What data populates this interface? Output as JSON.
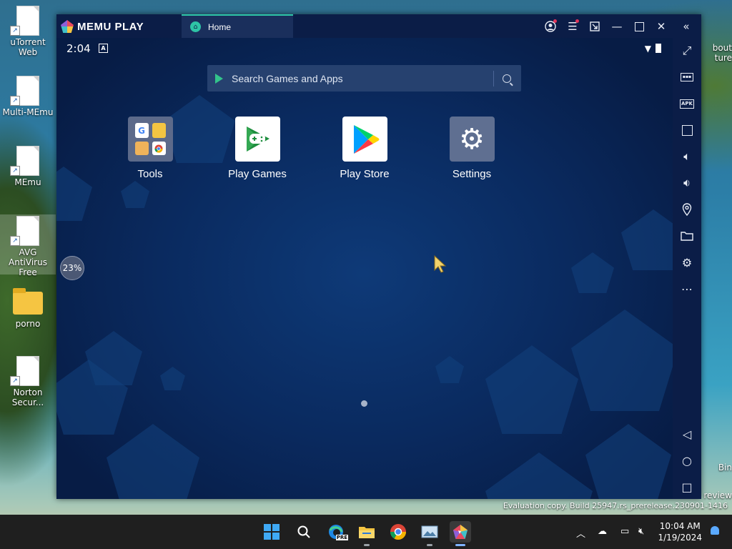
{
  "desktop": {
    "icons": [
      {
        "label": "uTorrent Web"
      },
      {
        "label": "Multi-MEmu"
      },
      {
        "label": "MEmu"
      },
      {
        "label": "AVG AntiVirus Free"
      },
      {
        "label": "porno"
      },
      {
        "label": "Norton Secur..."
      }
    ],
    "right_peek": {
      "top": "bout",
      "top2": "ture",
      "bin": "Bin",
      "review": "review"
    },
    "watermark": "Evaluation copy. Build 25947.rs_prerelease.230901-1416"
  },
  "emulator": {
    "brand": "MEMU PLAY",
    "tab_label": "Home",
    "status": {
      "time": "2:04",
      "a_icon": "A"
    },
    "search_placeholder": "Search Games and Apps",
    "apps": [
      {
        "label": "Tools"
      },
      {
        "label": "Play Games"
      },
      {
        "label": "Play Store"
      },
      {
        "label": "Settings"
      }
    ],
    "progress_text": "23%"
  },
  "taskbar": {
    "time": "10:04 AM",
    "date": "1/19/2024",
    "edge_badge": "PRE"
  },
  "colors": {
    "window_bg": "#0b1d47",
    "accent": "#2ec4a6",
    "screen_bg": "#0a2a5f"
  }
}
